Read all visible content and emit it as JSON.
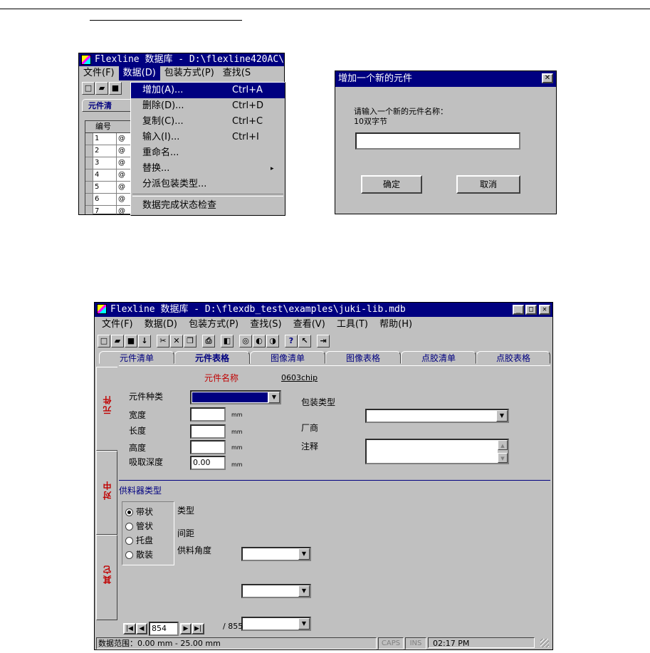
{
  "top": {
    "menu_window": {
      "title": "Flexline 数据库 - D:\\flexline420AC\\",
      "menus": [
        "文件(F)",
        "数据(D)",
        "包装方式(P)",
        "查找(S"
      ],
      "tab_label": "元件清",
      "column_header": "编号",
      "rows": [
        "1",
        "2",
        "3",
        "4",
        "5",
        "6",
        "7"
      ],
      "row_prefix": "@",
      "dropdown": [
        {
          "label": "增加(A)...",
          "shortcut": "Ctrl+A"
        },
        {
          "label": "删除(D)...",
          "shortcut": "Ctrl+D"
        },
        {
          "label": "复制(C)...",
          "shortcut": "Ctrl+C"
        },
        {
          "label": "输入(I)...",
          "shortcut": "Ctrl+I"
        },
        {
          "label": "重命名...",
          "shortcut": ""
        },
        {
          "label": "替换...",
          "shortcut": "▸"
        },
        {
          "label": "分派包装类型...",
          "shortcut": ""
        },
        {
          "label": "数据完成状态检查",
          "shortcut": ""
        }
      ]
    },
    "dialog": {
      "title": "增加一个新的元件",
      "close": "✕",
      "prompt": "请输入一个新的元件名称：",
      "hint": "10双字节",
      "input_value": "",
      "ok": "确定",
      "cancel": "取消"
    }
  },
  "main": {
    "title": "Flexline 数据库 - D:\\flexdb_test\\examples\\juki-lib.mdb",
    "menus": [
      "文件(F)",
      "数据(D)",
      "包装方式(P)",
      "查找(S)",
      "查看(V)",
      "工具(T)",
      "帮助(H)"
    ],
    "tabs": [
      "元件清单",
      "元件表格",
      "图像清单",
      "图像表格",
      "点胶清单",
      "点胶表格"
    ],
    "side_tabs": [
      "元件",
      "对中",
      "其它"
    ],
    "part_name_label": "元件名称",
    "part_name": "0603chip",
    "fields": {
      "type": "元件种类",
      "width": "宽度",
      "length": "长度",
      "height": "高度",
      "pickup": "吸取深度",
      "pickup_value": "0.00",
      "unit": "mm",
      "package": "包装类型",
      "vendor": "厂商",
      "comment": "注释"
    },
    "feeder": {
      "heading": "供料器类型",
      "radios": [
        "带状",
        "管状",
        "托盘",
        "散装"
      ],
      "selected": "带状",
      "type": "类型",
      "pitch": "间距",
      "angle": "供料角度"
    },
    "nav": {
      "record": "854",
      "total": "/ 855"
    },
    "status": {
      "range": "数据范围：0.00 mm - 25.00 mm",
      "caps": "CAPS",
      "ins": "INS",
      "time": "02:17 PM"
    }
  }
}
